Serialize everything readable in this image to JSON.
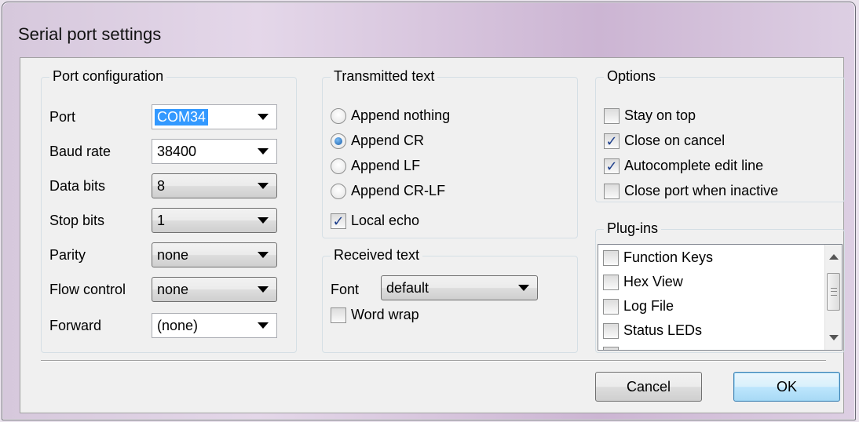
{
  "window": {
    "title": "Serial port settings"
  },
  "port_config": {
    "label": "Port configuration",
    "rows": [
      {
        "label": "Port",
        "value": "COM34",
        "selected": true
      },
      {
        "label": "Baud rate",
        "value": "38400"
      },
      {
        "label": "Data bits",
        "value": "8"
      },
      {
        "label": "Stop bits",
        "value": "1"
      },
      {
        "label": "Parity",
        "value": "none"
      },
      {
        "label": "Flow control",
        "value": "none"
      },
      {
        "label": "Forward",
        "value": "(none)"
      }
    ]
  },
  "transmitted": {
    "label": "Transmitted text",
    "options": [
      {
        "label": "Append nothing",
        "checked": false
      },
      {
        "label": "Append CR",
        "checked": true
      },
      {
        "label": "Append LF",
        "checked": false
      },
      {
        "label": "Append CR-LF",
        "checked": false
      }
    ],
    "local_echo": {
      "label": "Local echo",
      "checked": true
    }
  },
  "received": {
    "label": "Received text",
    "font_label": "Font",
    "font_value": "default",
    "word_wrap": {
      "label": "Word wrap",
      "checked": false
    }
  },
  "options": {
    "label": "Options",
    "items": [
      {
        "label": "Stay on top",
        "checked": false
      },
      {
        "label": "Close on cancel",
        "checked": true
      },
      {
        "label": "Autocomplete edit line",
        "checked": true
      },
      {
        "label": "Close port when inactive",
        "checked": false
      }
    ]
  },
  "plugins": {
    "label": "Plug-ins",
    "items": [
      {
        "label": "Function Keys",
        "checked": false
      },
      {
        "label": "Hex View",
        "checked": false
      },
      {
        "label": "Log File",
        "checked": false
      },
      {
        "label": "Status LEDs",
        "checked": false
      }
    ]
  },
  "buttons": {
    "cancel": "Cancel",
    "ok": "OK"
  },
  "icons": {
    "checkmark": "✓",
    "dropdown": "chevron-down-icon",
    "scroll_up": "scroll-up-icon",
    "scroll_down": "scroll-down-icon"
  }
}
